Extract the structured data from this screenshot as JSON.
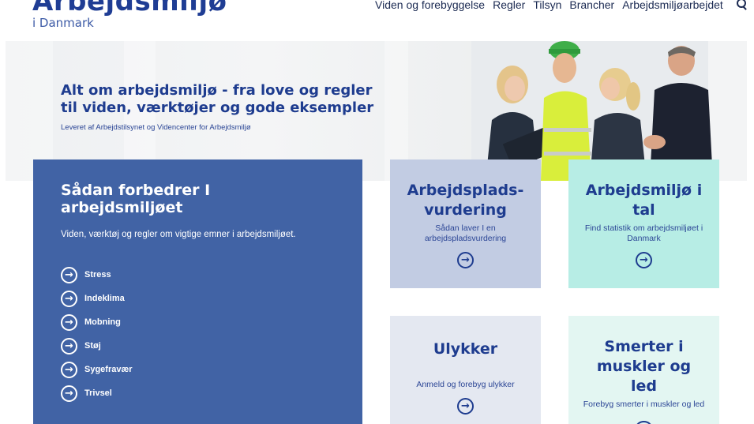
{
  "header": {
    "logo_main": "Arbejdsmiljø",
    "logo_sub": "i Danmark",
    "nav": [
      "Viden og forebyggelse",
      "Regler",
      "Tilsyn",
      "Brancher",
      "Arbejdsmiljøarbejdet"
    ],
    "search_icon": "search-icon"
  },
  "hero": {
    "title": "Alt om arbejdsmiljø - fra love og regler til viden, værktøjer og gode eksempler",
    "subtitle": "Leveret af Arbejdstilsynet og Videncenter for Arbejdsmiljø"
  },
  "main_card": {
    "title": "Sådan forbedrer I arbejdsmiljøet",
    "lead": "Viden, værktøj og regler om vigtige emner i arbejdsmiljøet.",
    "topics": [
      "Stress",
      "Indeklima",
      "Mobning",
      "Støj",
      "Sygefravær",
      "Trivsel"
    ],
    "color": "#4163a5"
  },
  "tiles": [
    {
      "title": "Arbejdsplads-vurdering",
      "text": "Sådan laver I en arbejdspladsvurdering",
      "color": "#c2cce3"
    },
    {
      "title": "Arbejdsmiljø i tal",
      "text": "Find statistik om arbejdsmiljøet i Danmark",
      "color": "#b7ede5"
    },
    {
      "title": "Ulykker",
      "text": "Anmeld og forebyg ulykker",
      "color": "#e4e8f1"
    },
    {
      "title": "Smerter i muskler og led",
      "text": "Forebyg smerter i muskler og led",
      "color": "#e3f6f2"
    }
  ]
}
